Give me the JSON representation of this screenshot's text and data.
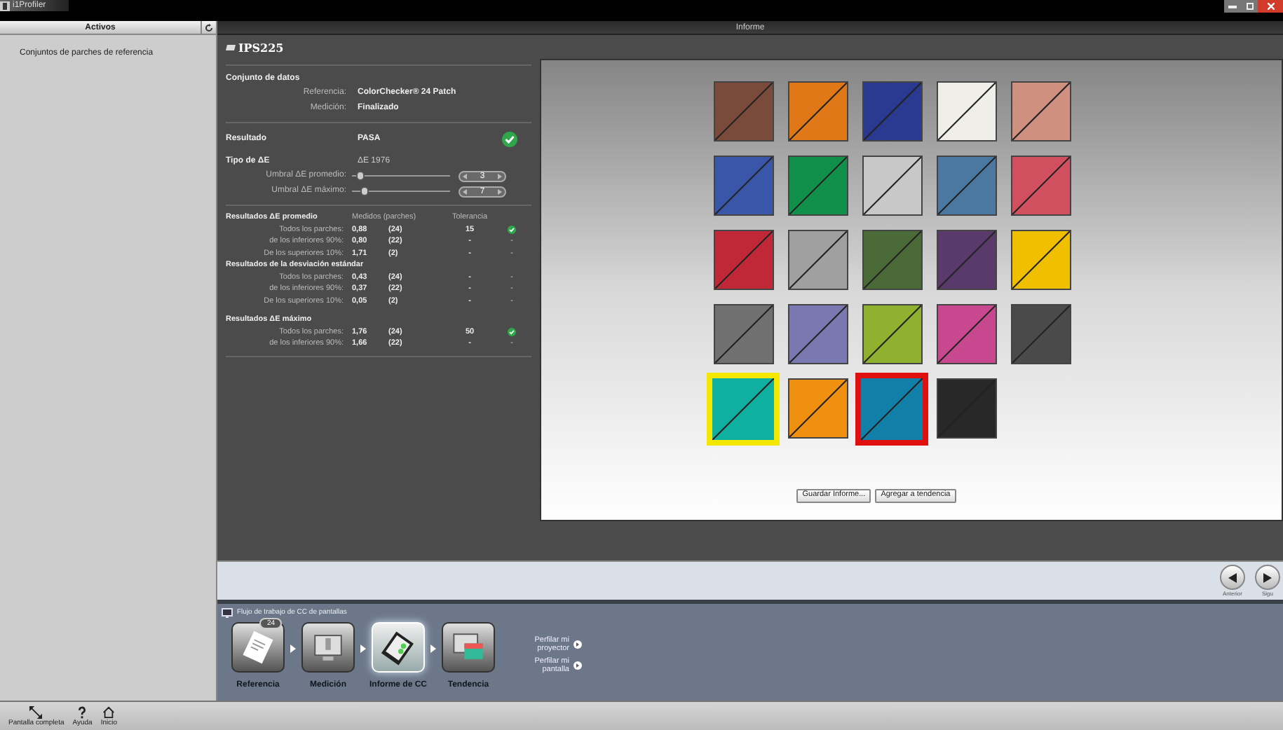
{
  "app_title": "i1Profiler",
  "sidebar": {
    "title": "Activos",
    "items": [
      {
        "label": "Conjuntos de parches de referencia",
        "selected": false
      }
    ]
  },
  "main_title": "Informe",
  "report": {
    "name": "IPS225",
    "dataset": {
      "title": "Conjunto de datos",
      "fields": [
        {
          "label": "Referencia:",
          "value": "ColorChecker® 24 Patch"
        },
        {
          "label": "Medición:",
          "value": "Finalizado"
        }
      ]
    },
    "result": {
      "label": "Resultado",
      "value": "PASA",
      "passed": true
    },
    "delta_type": {
      "label": "Tipo de ΔE",
      "value": "ΔE 1976"
    },
    "thresholds": [
      {
        "label": "Umbral ΔE promedio:",
        "level": 0.05,
        "value": "3"
      },
      {
        "label": "Umbral ΔE máximo:",
        "level": 0.1,
        "value": "7"
      }
    ],
    "columns": [
      "Medidos (parches)",
      "Tolerancia"
    ],
    "sections": [
      {
        "title": "Resultados ΔE promedio",
        "rows": [
          {
            "label": "Todos los parches:",
            "value": "0,88",
            "count": "(24)",
            "tolerance": "15",
            "passed": true
          },
          {
            "label": "de los inferiores 90%:",
            "value": "0,80",
            "count": "(22)",
            "tolerance": "-",
            "passed": false,
            "status": "-"
          },
          {
            "label": "De los superiores 10%:",
            "value": "1,71",
            "count": "(2)",
            "tolerance": "-",
            "passed": false,
            "status": "-"
          }
        ]
      },
      {
        "title": "Resultados de la desviación estándar",
        "rows": [
          {
            "label": "Todos los parches:",
            "value": "0,43",
            "count": "(24)",
            "tolerance": "-",
            "passed": false,
            "status": "-"
          },
          {
            "label": "de los inferiores 90%:",
            "value": "0,37",
            "count": "(22)",
            "tolerance": "-",
            "passed": false,
            "status": "-"
          },
          {
            "label": "De los superiores 10%:",
            "value": "0,05",
            "count": "(2)",
            "tolerance": "-",
            "passed": false,
            "status": "-"
          }
        ]
      },
      {
        "title": "Resultados ΔE máximo",
        "rows": [
          {
            "label": "Todos los parches:",
            "value": "1,76",
            "count": "(24)",
            "tolerance": "50",
            "passed": true
          },
          {
            "label": "de los inferiores 90%:",
            "value": "1,66",
            "count": "(22)",
            "tolerance": "-",
            "passed": false,
            "status": "-"
          }
        ]
      }
    ]
  },
  "patches": [
    {
      "color": "#7a4a3a"
    },
    {
      "color": "#e07818"
    },
    {
      "color": "#2a3a90"
    },
    {
      "color": "#f0eee8"
    },
    {
      "color": "#d09080"
    },
    {
      "color": "#3a56a8"
    },
    {
      "color": "#10904a"
    },
    {
      "color": "#c8c8c8"
    },
    {
      "color": "#4a78a0"
    },
    {
      "color": "#d05060"
    },
    {
      "color": "#c02838"
    },
    {
      "color": "#a0a0a0"
    },
    {
      "color": "#4a6a38"
    },
    {
      "color": "#5a3a6a"
    },
    {
      "color": "#f0c000"
    },
    {
      "color": "#707070"
    },
    {
      "color": "#7a78b0"
    },
    {
      "color": "#90b030"
    },
    {
      "color": "#c84890"
    },
    {
      "color": "#4a4a4a"
    },
    {
      "color": "#10b0a0",
      "frame": {
        "color": "#f5e800"
      }
    },
    {
      "color": "#f09010"
    },
    {
      "color": "#1080a8",
      "frame": {
        "color": "#e01010"
      }
    },
    {
      "color": "#282828"
    }
  ],
  "report_buttons": [
    "Guardar Informe...",
    "Agregar a tendencia"
  ],
  "nav": [
    {
      "kind": "back",
      "label": "Anterior"
    },
    {
      "kind": "next",
      "label": "Sigu"
    }
  ],
  "workflow": {
    "title": "Flujo de trabajo de CC de pantallas",
    "steps": [
      {
        "kind": "reference",
        "label": "Referencia",
        "badge": "24",
        "selected": false
      },
      {
        "kind": "measure",
        "label": "Medición",
        "selected": false
      },
      {
        "kind": "report",
        "label": "Informe de CC",
        "selected": true
      },
      {
        "kind": "trend",
        "label": "Tendencia",
        "selected": false
      }
    ],
    "links": [
      "Perfilar mi proyector",
      "Perfilar mi pantalla"
    ]
  },
  "bottom_bar": [
    {
      "kind": "fullscreen",
      "label": "Pantalla completa"
    },
    {
      "kind": "help",
      "label": "Ayuda"
    },
    {
      "kind": "home",
      "label": "Inicio"
    }
  ]
}
